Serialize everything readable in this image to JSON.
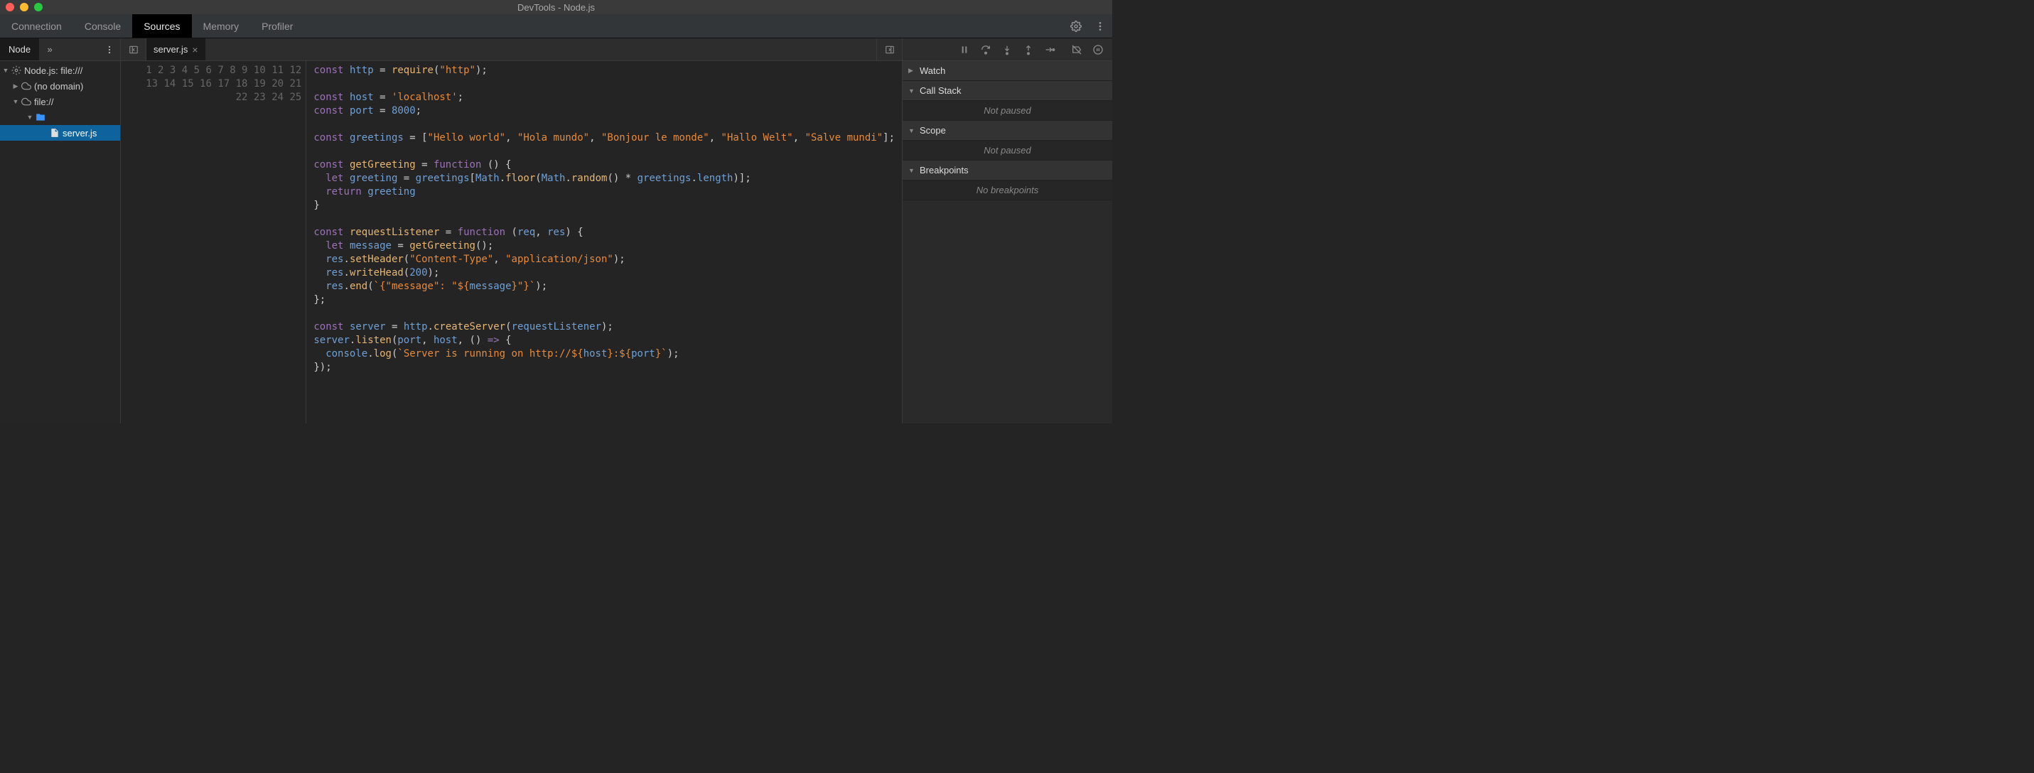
{
  "window": {
    "title": "DevTools - Node.js"
  },
  "topTabs": [
    "Connection",
    "Console",
    "Sources",
    "Memory",
    "Profiler"
  ],
  "topTabActive": 2,
  "sidebar": {
    "tab": "Node",
    "tree": {
      "root": "Node.js: file:///",
      "noDomain": "(no domain)",
      "fileScheme": "file://",
      "selectedFile": "server.js"
    }
  },
  "editor": {
    "openTab": "server.js",
    "lastLine": 25,
    "code": [
      {
        "n": 1,
        "html": "<span class='kw'>const</span> <span class='ident'>http</span> = <span class='fn'>require</span>(<span class='str'>\"http\"</span>);"
      },
      {
        "n": 2,
        "html": ""
      },
      {
        "n": 3,
        "html": "<span class='kw'>const</span> <span class='ident'>host</span> = <span class='str'>'localhost'</span>;"
      },
      {
        "n": 4,
        "html": "<span class='kw'>const</span> <span class='ident'>port</span> = <span class='num'>8000</span>;"
      },
      {
        "n": 5,
        "html": ""
      },
      {
        "n": 6,
        "html": "<span class='kw'>const</span> <span class='ident'>greetings</span> = [<span class='str'>\"Hello world\"</span>, <span class='str'>\"Hola mundo\"</span>, <span class='str'>\"Bonjour le monde\"</span>, <span class='str'>\"Hallo Welt\"</span>, <span class='str'>\"Salve mundi\"</span>];"
      },
      {
        "n": 7,
        "html": ""
      },
      {
        "n": 8,
        "html": "<span class='kw'>const</span> <span class='fn'>getGreeting</span> = <span class='kw'>function</span> () {"
      },
      {
        "n": 9,
        "html": "  <span class='kw'>let</span> <span class='ident'>greeting</span> = <span class='ident'>greetings</span>[<span class='ident'>Math</span>.<span class='fn'>floor</span>(<span class='ident'>Math</span>.<span class='fn'>random</span>() * <span class='ident'>greetings</span>.<span class='prop'>length</span>)];"
      },
      {
        "n": 10,
        "html": "  <span class='kw'>return</span> <span class='ident'>greeting</span>"
      },
      {
        "n": 11,
        "html": "}"
      },
      {
        "n": 12,
        "html": ""
      },
      {
        "n": 13,
        "html": "<span class='kw'>const</span> <span class='fn'>requestListener</span> = <span class='kw'>function</span> (<span class='ident'>req</span>, <span class='ident'>res</span>) {"
      },
      {
        "n": 14,
        "html": "  <span class='kw'>let</span> <span class='ident'>message</span> = <span class='fn'>getGreeting</span>();"
      },
      {
        "n": 15,
        "html": "  <span class='ident'>res</span>.<span class='fn'>setHeader</span>(<span class='str'>\"Content-Type\"</span>, <span class='str'>\"application/json\"</span>);"
      },
      {
        "n": 16,
        "html": "  <span class='ident'>res</span>.<span class='fn'>writeHead</span>(<span class='num'>200</span>);"
      },
      {
        "n": 17,
        "html": "  <span class='ident'>res</span>.<span class='fn'>end</span>(<span class='str'>`{\"message\": \"${</span><span class='ident'>message</span><span class='str'>}\"}`</span>);"
      },
      {
        "n": 18,
        "html": "};"
      },
      {
        "n": 19,
        "html": ""
      },
      {
        "n": 20,
        "html": "<span class='kw'>const</span> <span class='ident'>server</span> = <span class='ident'>http</span>.<span class='fn'>createServer</span>(<span class='ident'>requestListener</span>);"
      },
      {
        "n": 21,
        "html": "<span class='ident'>server</span>.<span class='fn'>listen</span>(<span class='ident'>port</span>, <span class='ident'>host</span>, () <span class='kw'>=&gt;</span> {"
      },
      {
        "n": 22,
        "html": "  <span class='ident'>console</span>.<span class='fn'>log</span>(<span class='str'>`Server is running on http://${</span><span class='ident'>host</span><span class='str'>}:${</span><span class='ident'>port</span><span class='str'>}`</span>);"
      },
      {
        "n": 23,
        "html": "});"
      },
      {
        "n": 24,
        "html": ""
      },
      {
        "n": 25,
        "html": ""
      }
    ]
  },
  "rightPanel": {
    "sections": {
      "watch": "Watch",
      "callStack": "Call Stack",
      "scope": "Scope",
      "breakpoints": "Breakpoints"
    },
    "notPaused": "Not paused",
    "noBreakpoints": "No breakpoints"
  }
}
